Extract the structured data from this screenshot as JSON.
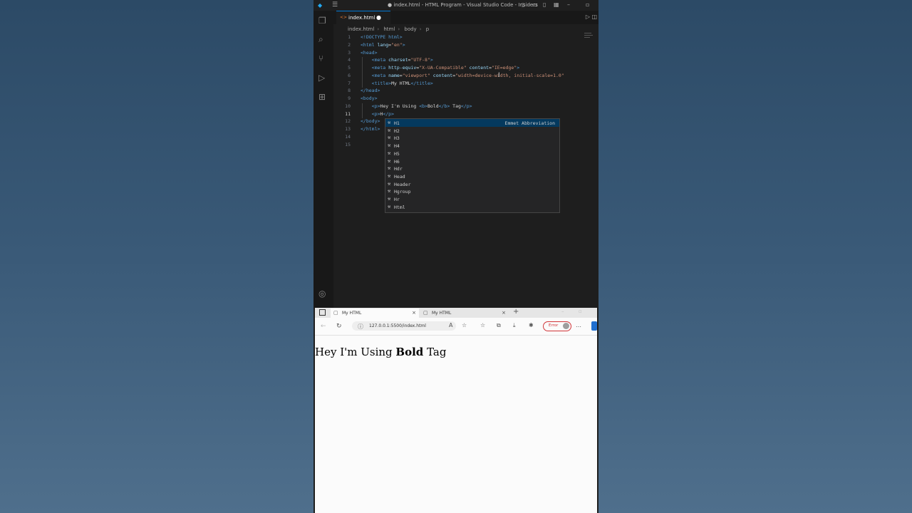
{
  "vscode": {
    "window_title": "● index.html - HTML Program - Visual Studio Code - Insiders",
    "tab": {
      "name": "index.html",
      "modified_dot": "●"
    },
    "breadcrumb": [
      "index.html",
      "html",
      "body",
      "p"
    ],
    "line_numbers": [
      "1",
      "2",
      "3",
      "4",
      "5",
      "6",
      "7",
      "8",
      "9",
      "10",
      "11",
      "12",
      "13",
      "14",
      "15"
    ],
    "active_line": "11",
    "code_lines": [
      [
        {
          "t": "tag",
          "v": "<!DOCTYPE html>"
        }
      ],
      [
        {
          "t": "tag",
          "v": "<html "
        },
        {
          "t": "attr",
          "v": "lang"
        },
        {
          "t": "txt",
          "v": "="
        },
        {
          "t": "str",
          "v": "\"en\""
        },
        {
          "t": "tag",
          "v": ">"
        }
      ],
      [
        {
          "t": "tag",
          "v": "<head>"
        }
      ],
      [
        {
          "t": "txt",
          "v": "    "
        },
        {
          "t": "tag",
          "v": "<meta "
        },
        {
          "t": "attr",
          "v": "charset"
        },
        {
          "t": "txt",
          "v": "="
        },
        {
          "t": "str",
          "v": "\"UTF-8\""
        },
        {
          "t": "tag",
          "v": ">"
        }
      ],
      [
        {
          "t": "txt",
          "v": "    "
        },
        {
          "t": "tag",
          "v": "<meta "
        },
        {
          "t": "attr",
          "v": "http-equiv"
        },
        {
          "t": "txt",
          "v": "="
        },
        {
          "t": "str",
          "v": "\"X-UA-Compatible\""
        },
        {
          "t": "txt",
          "v": " "
        },
        {
          "t": "attr",
          "v": "content"
        },
        {
          "t": "txt",
          "v": "="
        },
        {
          "t": "str",
          "v": "\"IE=edge\""
        },
        {
          "t": "tag",
          "v": ">"
        }
      ],
      [
        {
          "t": "txt",
          "v": "    "
        },
        {
          "t": "tag",
          "v": "<meta "
        },
        {
          "t": "attr",
          "v": "name"
        },
        {
          "t": "txt",
          "v": "="
        },
        {
          "t": "str",
          "v": "\"viewport\""
        },
        {
          "t": "txt",
          "v": " "
        },
        {
          "t": "attr",
          "v": "content"
        },
        {
          "t": "txt",
          "v": "="
        },
        {
          "t": "str",
          "v": "\"width=device-width, initial-scale=1.0\""
        }
      ],
      [
        {
          "t": "txt",
          "v": "    "
        },
        {
          "t": "tag",
          "v": "<title>"
        },
        {
          "t": "txt",
          "v": "My HTML"
        },
        {
          "t": "tag",
          "v": "</title>"
        }
      ],
      [
        {
          "t": "tag",
          "v": "</head>"
        }
      ],
      [
        {
          "t": "tag",
          "v": "<body>"
        }
      ],
      [
        {
          "t": "txt",
          "v": "    "
        },
        {
          "t": "tag",
          "v": "<p>"
        },
        {
          "t": "txt",
          "v": "Hey I'm Using "
        },
        {
          "t": "tag",
          "v": "<b>"
        },
        {
          "t": "txt",
          "v": "Bold"
        },
        {
          "t": "tag",
          "v": "</b>"
        },
        {
          "t": "txt",
          "v": " Tag"
        },
        {
          "t": "tag",
          "v": "</p>"
        }
      ],
      [
        {
          "t": "txt",
          "v": "    "
        },
        {
          "t": "tag",
          "v": "<p>"
        },
        {
          "t": "txt",
          "v": "H"
        },
        {
          "t": "tag",
          "v": "</p>"
        }
      ],
      [
        {
          "t": "tag",
          "v": "</body>"
        }
      ],
      [
        {
          "t": "tag",
          "v": "</html>"
        }
      ],
      [],
      []
    ],
    "suggestions": [
      {
        "label": "H1",
        "detail": "Emmet Abbreviation"
      },
      {
        "label": "H2"
      },
      {
        "label": "H3"
      },
      {
        "label": "H4"
      },
      {
        "label": "H5"
      },
      {
        "label": "H6"
      },
      {
        "label": "Hdr"
      },
      {
        "label": "Head"
      },
      {
        "label": "Header"
      },
      {
        "label": "Hgroup"
      },
      {
        "label": "Hr"
      },
      {
        "label": "Html"
      }
    ]
  },
  "browser": {
    "tabs": [
      {
        "label": "My HTML"
      },
      {
        "label": "My HTML"
      }
    ],
    "url": "127.0.0.1:5500/index.html",
    "error_label": "Error",
    "page": {
      "text_before": "Hey I'm Using ",
      "bold": "Bold",
      "text_after": " Tag"
    }
  }
}
